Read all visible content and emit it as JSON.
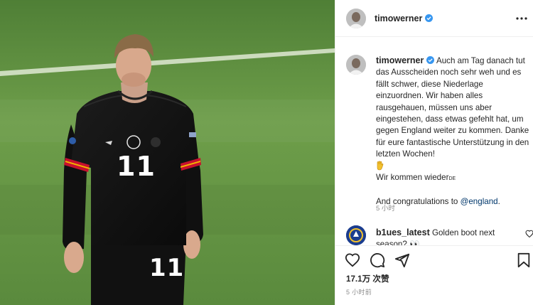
{
  "post": {
    "username": "timowerner",
    "verified": true
  },
  "caption": {
    "username": "timowerner",
    "line1": "Auch am Tag danach tut das Ausscheiden noch sehr weh und es fällt schwer, diese Niederlage einzuordnen. Wir haben alles rausgehauen, müssen uns aber eingestehen, dass etwas gefehlt hat, um gegen England weiter zu kommen. Danke für eure fantastische Unterstützung in den letzten Wochen!",
    "line2": "Wir kommen wieder",
    "flag_text": "DE",
    "line3_prefix": "And congratulations to ",
    "mention": "@england",
    "line3_suffix": ".",
    "time": "5 小时"
  },
  "comment": {
    "username": "b1ues_latest",
    "text": "Golden boot next season? ",
    "emoji": "👀"
  },
  "likes_text": "17.1万 次赞",
  "timestamp": "5 小时前",
  "photo": {
    "jersey_number": "11",
    "shorts_number": "11"
  },
  "icons": {
    "more": "more-options-icon",
    "like": "heart-icon",
    "comment": "comment-icon",
    "share": "share-icon",
    "save": "bookmark-icon"
  },
  "colors": {
    "verified": "#3897f0",
    "mention": "#00376b",
    "muted": "#8e8e8e",
    "pitch": "#5f8e42",
    "jersey": "#141414"
  }
}
